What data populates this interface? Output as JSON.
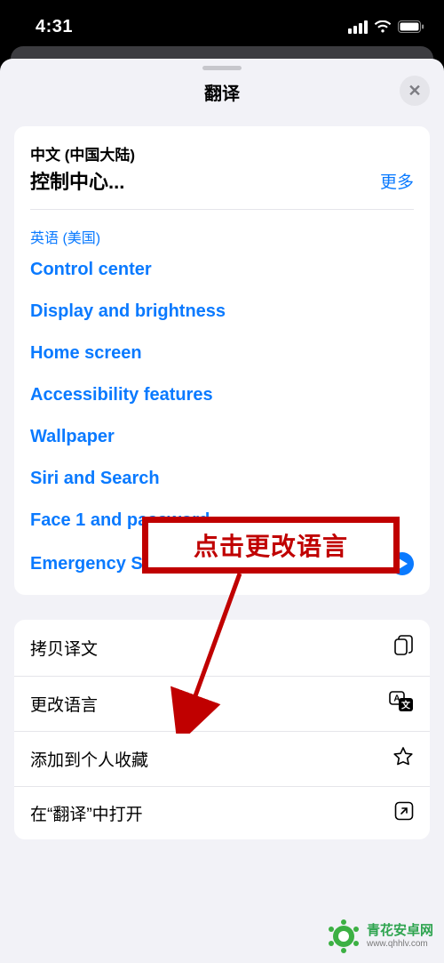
{
  "status": {
    "time": "4:31"
  },
  "sheet": {
    "title": "翻译",
    "source": {
      "lang_label": "中文 (中国大陆)",
      "text": "控制中心...",
      "more_label": "更多"
    },
    "target": {
      "lang_label": "英语 (美国)",
      "items": [
        "Control center",
        "Display and brightness",
        "Home screen",
        "Accessibility features",
        "Wallpaper",
        "Siri and Search",
        "Face 1 and password",
        "Emergency SOS"
      ]
    },
    "actions": {
      "copy": "拷贝译文",
      "change_lang": "更改语言",
      "favorite": "添加到个人收藏",
      "open_in_app": "在“翻译”中打开"
    }
  },
  "annotation": {
    "callout": "点击更改语言"
  },
  "watermark": {
    "name": "青花安卓网",
    "url": "www.qhhlv.com"
  },
  "colors": {
    "accent": "#0a7aff",
    "callout": "#c00000",
    "sheet_bg": "#f2f2f7"
  }
}
